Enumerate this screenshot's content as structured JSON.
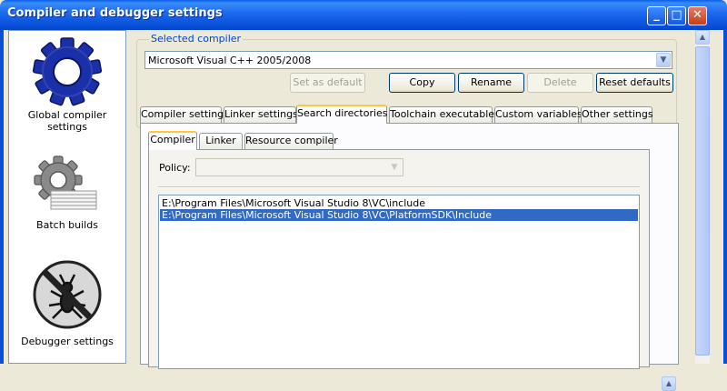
{
  "window": {
    "title": "Compiler and debugger settings",
    "controls": {
      "minimize": "_",
      "maximize": "□",
      "close": "✕"
    }
  },
  "sidebar": {
    "items": [
      {
        "label": "Global compiler settings",
        "icon": "gear-icon"
      },
      {
        "label": "Batch builds",
        "icon": "gear-stack-icon"
      },
      {
        "label": "Debugger settings",
        "icon": "no-bug-icon"
      }
    ]
  },
  "selected_compiler": {
    "legend": "Selected compiler",
    "value": "Microsoft Visual C++ 2005/2008",
    "buttons": {
      "set_default": "Set as default",
      "copy": "Copy",
      "rename": "Rename",
      "delete": "Delete",
      "reset": "Reset defaults"
    }
  },
  "tabs": [
    "Compiler settings",
    "Linker settings",
    "Search directories",
    "Toolchain executables",
    "Custom variables",
    "Other settings"
  ],
  "subtabs": [
    "Compiler",
    "Linker",
    "Resource compiler"
  ],
  "policy": {
    "label": "Policy:",
    "value": ""
  },
  "directories": [
    "E:\\Program Files\\Microsoft Visual Studio 8\\VC\\include",
    "E:\\Program Files\\Microsoft Visual Studio 8\\VC\\PlatformSDK\\Include"
  ],
  "selected_directory_index": 1,
  "scroll": {
    "up": "▲",
    "down": "▼"
  },
  "colors": {
    "titlebar": "#0a5ee8",
    "selection": "#316ac5",
    "group_legend": "#0046d5",
    "active_tab_accent": "#ffc83c"
  }
}
